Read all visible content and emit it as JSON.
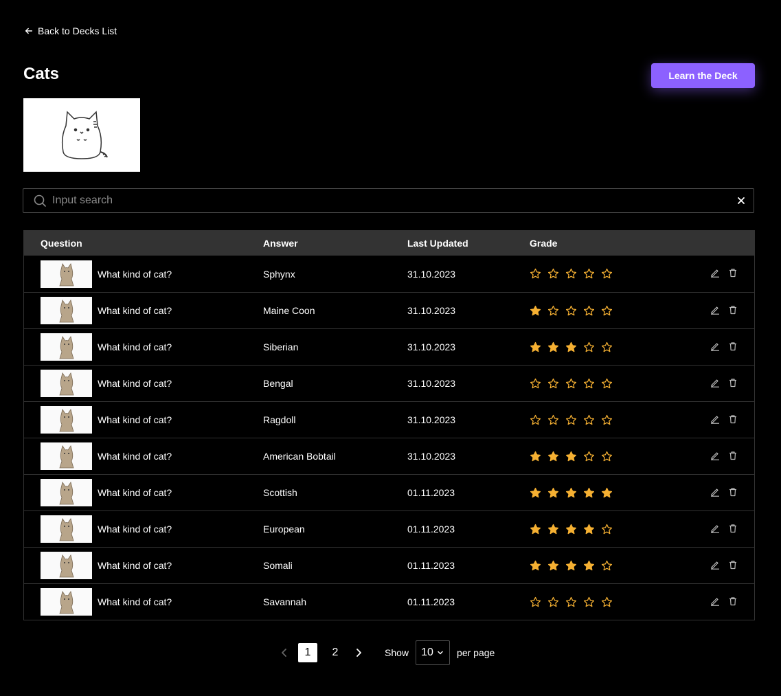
{
  "back_link": "Back to Decks List",
  "deck_title": "Cats",
  "learn_button": "Learn the Deck",
  "search": {
    "placeholder": "Input search"
  },
  "table": {
    "headers": {
      "question": "Question",
      "answer": "Answer",
      "updated": "Last Updated",
      "grade": "Grade"
    },
    "rows": [
      {
        "question": "What kind of cat?",
        "answer": "Sphynx",
        "updated": "31.10.2023",
        "grade": 0
      },
      {
        "question": "What kind of cat?",
        "answer": "Maine Coon",
        "updated": "31.10.2023",
        "grade": 1
      },
      {
        "question": "What kind of cat?",
        "answer": "Siberian",
        "updated": "31.10.2023",
        "grade": 3
      },
      {
        "question": "What kind of cat?",
        "answer": "Bengal",
        "updated": "31.10.2023",
        "grade": 0
      },
      {
        "question": "What kind of cat?",
        "answer": "Ragdoll",
        "updated": "31.10.2023",
        "grade": 0
      },
      {
        "question": "What kind of cat?",
        "answer": "American Bobtail",
        "updated": "31.10.2023",
        "grade": 3
      },
      {
        "question": "What kind of cat?",
        "answer": "Scottish",
        "updated": "01.11.2023",
        "grade": 5
      },
      {
        "question": "What kind of cat?",
        "answer": "European",
        "updated": "01.11.2023",
        "grade": 4
      },
      {
        "question": "What kind of cat?",
        "answer": "Somali",
        "updated": "01.11.2023",
        "grade": 4
      },
      {
        "question": "What kind of cat?",
        "answer": "Savannah",
        "updated": "01.11.2023",
        "grade": 0
      }
    ]
  },
  "pagination": {
    "pages": [
      "1",
      "2"
    ],
    "current": "1",
    "show_label": "Show",
    "per_page": "10",
    "per_page_label": "per page"
  },
  "colors": {
    "accent": "#8c61ff",
    "star": "#f5b032"
  }
}
